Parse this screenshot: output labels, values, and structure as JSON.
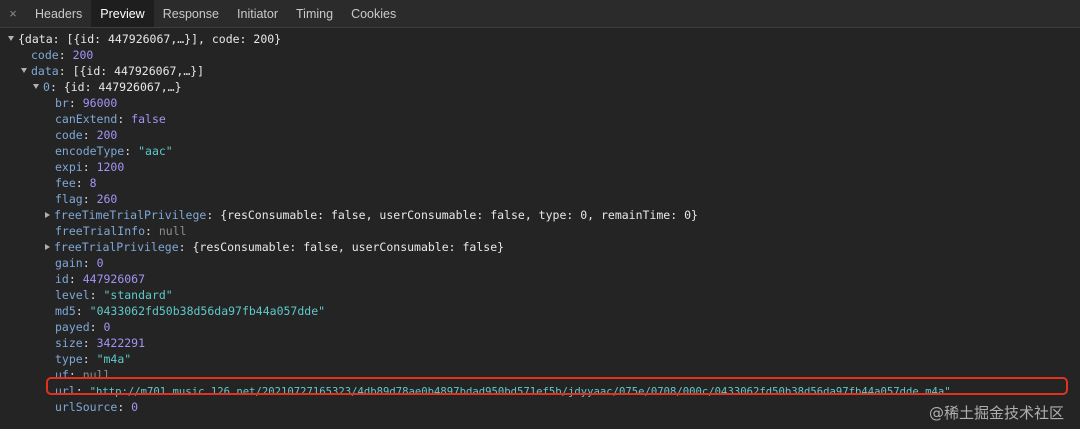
{
  "tabs": {
    "close": "×",
    "items": [
      "Headers",
      "Preview",
      "Response",
      "Initiator",
      "Timing",
      "Cookies"
    ]
  },
  "tree": {
    "root_summary": "{data: [{id: 447926067,…}], code: 200}",
    "code_key": "code",
    "code_val": "200",
    "data_key": "data",
    "data_summary": "[{id: 447926067,…}]",
    "item_key": "0",
    "item_summary": "{id: 447926067,…}",
    "fields": {
      "br": {
        "k": "br",
        "v": "96000"
      },
      "canExtend": {
        "k": "canExtend",
        "v": "false"
      },
      "code": {
        "k": "code",
        "v": "200"
      },
      "encodeType": {
        "k": "encodeType",
        "v": "\"aac\""
      },
      "expi": {
        "k": "expi",
        "v": "1200"
      },
      "fee": {
        "k": "fee",
        "v": "8"
      },
      "flag": {
        "k": "flag",
        "v": "260"
      },
      "freeTimeTrialPrivilege": {
        "k": "freeTimeTrialPrivilege",
        "v": "{resConsumable: false, userConsumable: false, type: 0, remainTime: 0}"
      },
      "freeTrialInfo": {
        "k": "freeTrialInfo",
        "v": "null"
      },
      "freeTrialPrivilege": {
        "k": "freeTrialPrivilege",
        "v": "{resConsumable: false, userConsumable: false}"
      },
      "gain": {
        "k": "gain",
        "v": "0"
      },
      "id": {
        "k": "id",
        "v": "447926067"
      },
      "level": {
        "k": "level",
        "v": "\"standard\""
      },
      "md5": {
        "k": "md5",
        "v": "\"0433062fd50b38d56da97fb44a057dde\""
      },
      "payed": {
        "k": "payed",
        "v": "0"
      },
      "size": {
        "k": "size",
        "v": "3422291"
      },
      "type": {
        "k": "type",
        "v": "\"m4a\""
      },
      "uf": {
        "k": "uf",
        "v": "null"
      },
      "url": {
        "k": "url",
        "v": "\"http://m701.music.126.net/20210727165323/4db89d78ae0b4897bdad950bd571ef5b/jdyyaac/075e/0708/000c/0433062fd50b38d56da97fb44a057dde.m4a\""
      },
      "urlSource": {
        "k": "urlSource",
        "v": "0"
      }
    }
  },
  "watermark": "@稀土掘金技术社区"
}
